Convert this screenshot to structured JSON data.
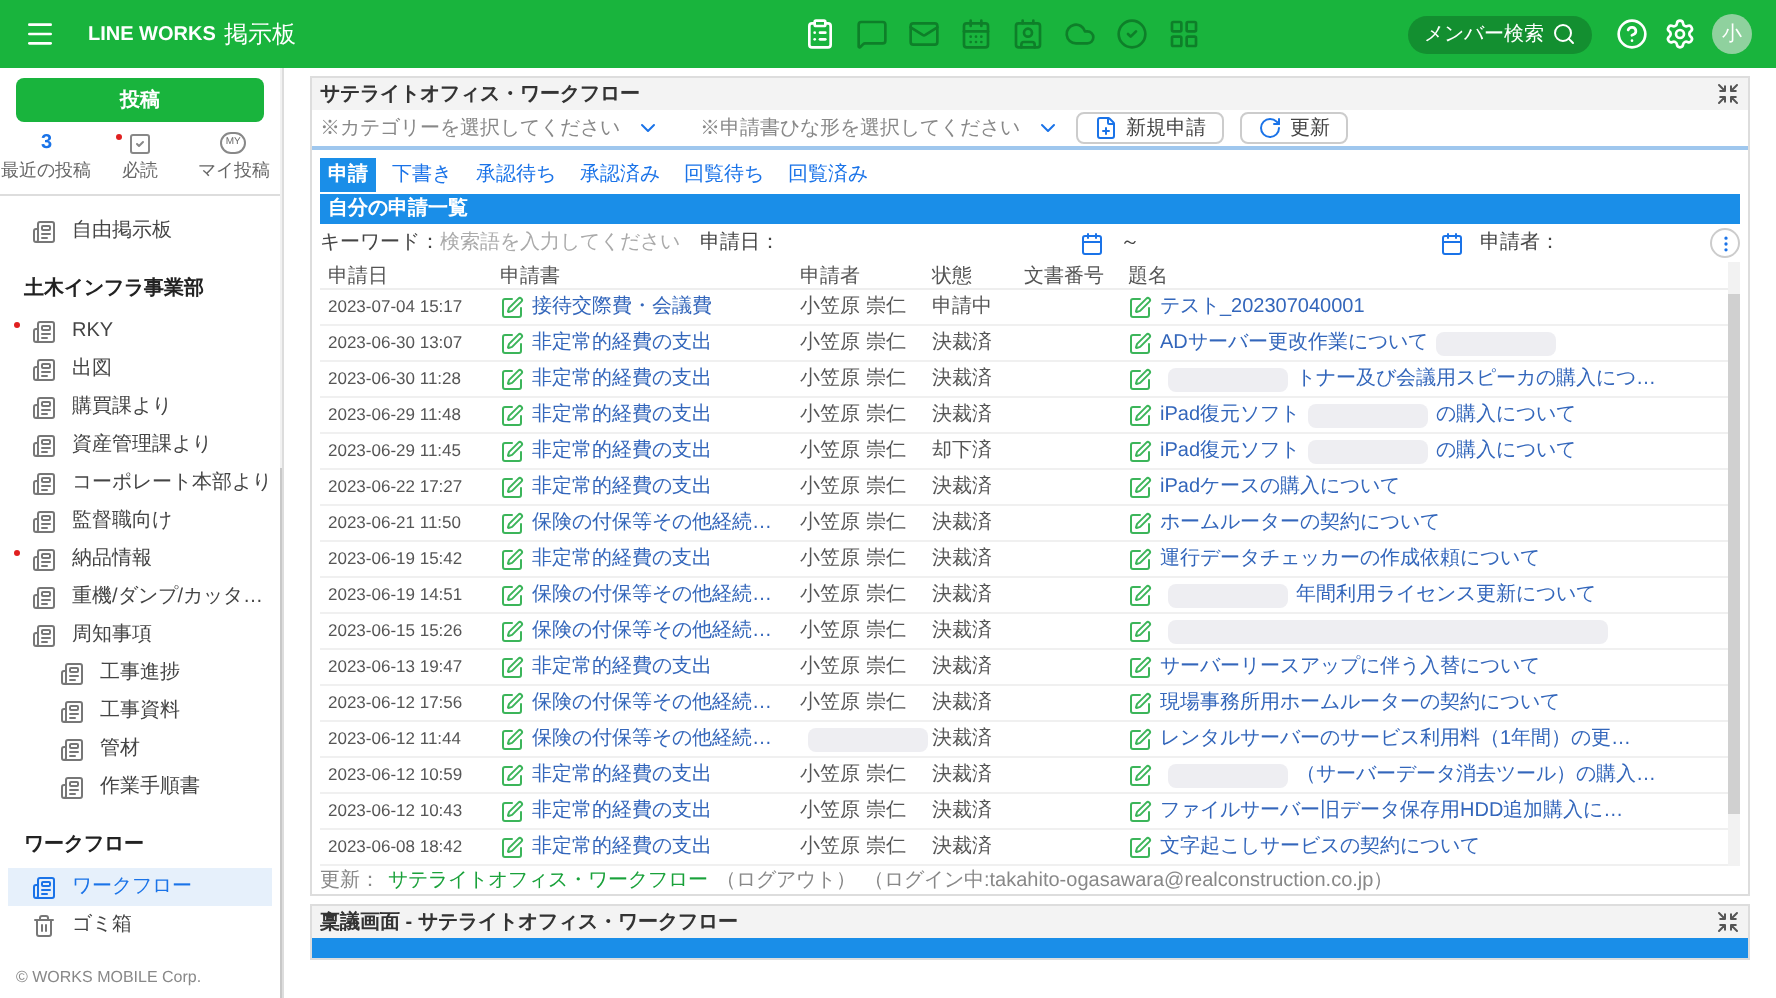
{
  "header": {
    "brand": "LINE WORKS",
    "app": "掲示板",
    "apps": [
      {
        "selected": true
      },
      {
        "selected": false
      },
      {
        "selected": false
      },
      {
        "selected": false
      },
      {
        "selected": false
      },
      {
        "selected": false
      },
      {
        "selected": false
      },
      {
        "selected": false
      }
    ],
    "member_search": "メンバー検索",
    "avatar": "小"
  },
  "sidebar": {
    "post_button": "投稿",
    "shortcuts": [
      {
        "kind": "count",
        "count": "3",
        "label": "最近の投稿",
        "unread": false
      },
      {
        "kind": "check",
        "label": "必読",
        "unread": true
      },
      {
        "kind": "badge",
        "badge": "MY",
        "label": "マイ投稿",
        "unread": false
      }
    ],
    "items": [
      {
        "kind": "board",
        "label": "自由掲示板",
        "unread": false,
        "selected": false
      },
      {
        "kind": "section",
        "label": "土木インフラ事業部"
      },
      {
        "kind": "board",
        "label": "RKY",
        "unread": true,
        "selected": false
      },
      {
        "kind": "board",
        "label": "出図",
        "unread": false,
        "selected": false
      },
      {
        "kind": "board",
        "label": "購買課より",
        "unread": false,
        "selected": false
      },
      {
        "kind": "board",
        "label": "資産管理課より",
        "unread": false,
        "selected": false
      },
      {
        "kind": "board",
        "label": "コーポレート本部より",
        "unread": false,
        "selected": false
      },
      {
        "kind": "board",
        "label": "監督職向け",
        "unread": false,
        "selected": false
      },
      {
        "kind": "board",
        "label": "納品情報",
        "unread": true,
        "selected": false
      },
      {
        "kind": "board",
        "label": "重機/ダンプ/カッタ…",
        "unread": false,
        "selected": false
      },
      {
        "kind": "board",
        "label": "周知事項",
        "unread": false,
        "selected": false,
        "children": [
          {
            "label": "工事進捗",
            "unread": false,
            "selected": false
          },
          {
            "label": "工事資料",
            "unread": false,
            "selected": false
          },
          {
            "label": "管材",
            "unread": false,
            "selected": false
          },
          {
            "label": "作業手順書",
            "unread": false,
            "selected": false
          }
        ]
      },
      {
        "kind": "section",
        "label": "ワークフロー"
      },
      {
        "kind": "board",
        "label": "ワークフロー",
        "unread": false,
        "selected": true
      },
      {
        "kind": "trash",
        "label": "ゴミ箱",
        "unread": false,
        "selected": false
      }
    ],
    "copyright": "© WORKS MOBILE Corp."
  },
  "panel": {
    "title": "サテライトオフィス・ワークフロー",
    "category_select": "※カテゴリーを選択してください",
    "template_select": "※申請書ひな形を選択してください",
    "buttons": [
      {
        "kind": "new",
        "label": "新規申請"
      },
      {
        "kind": "refresh",
        "label": "更新"
      }
    ],
    "tabs": [
      {
        "label": "申請",
        "selected": true
      },
      {
        "label": "下書き",
        "selected": false
      },
      {
        "label": "承認待ち",
        "selected": false
      },
      {
        "label": "承認済み",
        "selected": false
      },
      {
        "label": "回覧待ち",
        "selected": false
      },
      {
        "label": "回覧済み",
        "selected": false
      }
    ],
    "list_title": "自分の申請一覧",
    "filter": {
      "keyword_label": "キーワード：",
      "placeholder": "検索語を入力してください",
      "date_label": "申請日：",
      "range": "～",
      "applicant_label": "申請者："
    },
    "columns": [
      "申請日",
      "申請書",
      "申請者",
      "状態",
      "文書番号",
      "題名"
    ],
    "rows": [
      {
        "date": "2023-07-04 15:17",
        "form": "接待交際費・会議費",
        "applicant": "小笠原 崇仁",
        "status": "申請中",
        "title": [
          {
            "text": "テスト_202307040001"
          }
        ]
      },
      {
        "date": "2023-06-30 13:07",
        "form": "非定常的経費の支出",
        "applicant": "小笠原 崇仁",
        "status": "決裁済",
        "title": [
          {
            "text": "ADサーバー更改作業について"
          },
          {
            "kind": "redacted"
          }
        ]
      },
      {
        "date": "2023-06-30 11:28",
        "form": "非定常的経費の支出",
        "applicant": "小笠原 崇仁",
        "status": "決裁済",
        "title": [
          {
            "kind": "redacted"
          },
          {
            "text": "トナー及び会議用スピーカの購入につ…"
          }
        ]
      },
      {
        "date": "2023-06-29 11:48",
        "form": "非定常的経費の支出",
        "applicant": "小笠原 崇仁",
        "status": "決裁済",
        "title": [
          {
            "text": "iPad復元ソフト"
          },
          {
            "kind": "redacted"
          },
          {
            "text": "の購入について"
          }
        ]
      },
      {
        "date": "2023-06-29 11:45",
        "form": "非定常的経費の支出",
        "applicant": "小笠原 崇仁",
        "status": "却下済",
        "title": [
          {
            "text": "iPad復元ソフト"
          },
          {
            "kind": "redacted"
          },
          {
            "text": "の購入について"
          }
        ]
      },
      {
        "date": "2023-06-22 17:27",
        "form": "非定常的経費の支出",
        "applicant": "小笠原 崇仁",
        "status": "決裁済",
        "title": [
          {
            "text": "iPadケースの購入について"
          }
        ]
      },
      {
        "date": "2023-06-21 11:50",
        "form": "保険の付保等その他経続…",
        "applicant": "小笠原 崇仁",
        "status": "決裁済",
        "title": [
          {
            "text": "ホームルーターの契約について"
          }
        ]
      },
      {
        "date": "2023-06-19 15:42",
        "form": "非定常的経費の支出",
        "applicant": "小笠原 崇仁",
        "status": "決裁済",
        "title": [
          {
            "text": "運行データチェッカーの作成依頼について"
          }
        ]
      },
      {
        "date": "2023-06-19 14:51",
        "form": "保険の付保等その他経続…",
        "applicant": "小笠原 崇仁",
        "status": "決裁済",
        "title": [
          {
            "kind": "redacted"
          },
          {
            "text": "年間利用ライセンス更新について"
          }
        ]
      },
      {
        "date": "2023-06-15 15:26",
        "form": "保険の付保等その他経続…",
        "applicant": "小笠原 崇仁",
        "status": "決裁済",
        "title": [
          {
            "kind": "redacted",
            "wide": true
          }
        ]
      },
      {
        "date": "2023-06-13 19:47",
        "form": "非定常的経費の支出",
        "applicant": "小笠原 崇仁",
        "status": "決裁済",
        "title": [
          {
            "text": "サーバーリースアップに伴う入替について"
          }
        ]
      },
      {
        "date": "2023-06-12 17:56",
        "form": "保険の付保等その他経続…",
        "applicant": "小笠原 崇仁",
        "status": "決裁済",
        "title": [
          {
            "text": "現場事務所用ホームルーターの契約について"
          }
        ]
      },
      {
        "date": "2023-06-12 11:44",
        "form": "保険の付保等その他経続…",
        "applicant_redacted": true,
        "status": "決裁済",
        "title": [
          {
            "text": "レンタルサーバーのサービス利用料（1年間）の更…"
          }
        ]
      },
      {
        "date": "2023-06-12 10:59",
        "form": "非定常的経費の支出",
        "applicant": "小笠原 崇仁",
        "status": "決裁済",
        "title": [
          {
            "kind": "redacted"
          },
          {
            "text": "（サーバーデータ消去ツール）の購入…"
          }
        ]
      },
      {
        "date": "2023-06-12 10:43",
        "form": "非定常的経費の支出",
        "applicant": "小笠原 崇仁",
        "status": "決裁済",
        "title": [
          {
            "text": "ファイルサーバー旧データ保存用HDD追加購入に…"
          }
        ]
      },
      {
        "date": "2023-06-08 18:42",
        "form": "非定常的経費の支出",
        "applicant": "小笠原 崇仁",
        "status": "決裁済",
        "title": [
          {
            "text": "文字起こしサービスの契約について"
          }
        ]
      }
    ],
    "footer": {
      "prefix": "更新：",
      "link": "サテライトオフィス・ワークフロー",
      "logout": "（ログアウト）",
      "login": "（ログイン中:takahito-ogasawara@realconstruction.co.jp）"
    }
  },
  "second_panel": {
    "title": "稟議画面 - サテライトオフィス・ワークフロー"
  }
}
